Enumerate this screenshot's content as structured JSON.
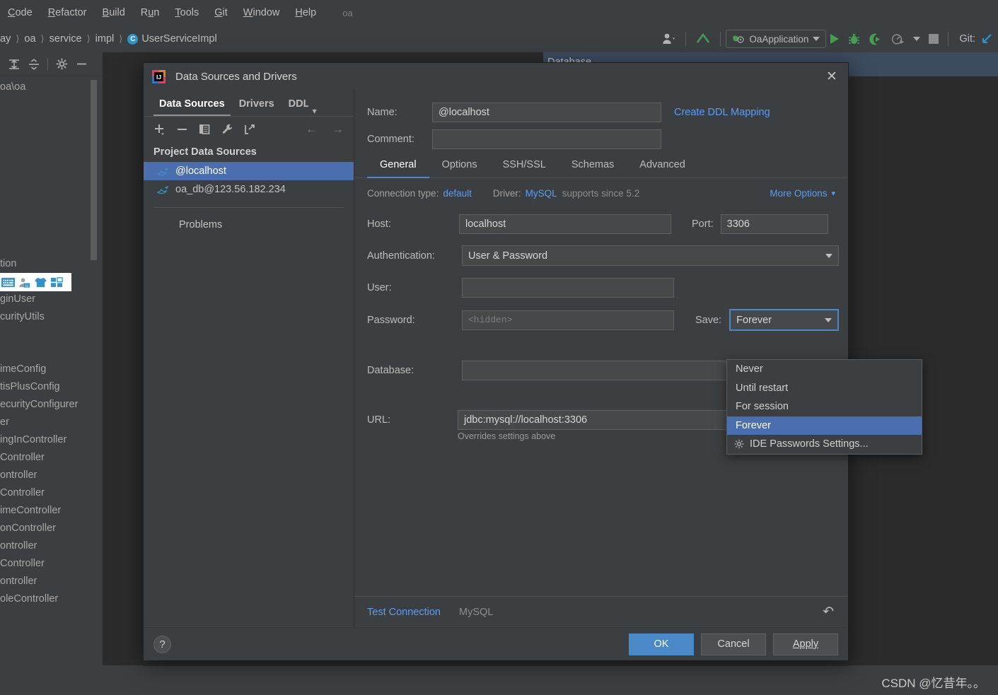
{
  "ide": {
    "menu": [
      "Code",
      "Refactor",
      "Build",
      "Run",
      "Tools",
      "Git",
      "Window",
      "Help"
    ],
    "project_hint": "oa",
    "breadcrumbs": [
      "ay",
      "oa",
      "service",
      "impl",
      "UserServiceImpl"
    ],
    "class_icon_letter": "C",
    "run_config": "OaApplication",
    "git_label": "Git:",
    "tool_window_title": "Database",
    "tree_items": [
      "oa\\oa",
      "",
      "",
      "",
      "",
      "",
      "",
      "",
      "",
      "",
      "tion",
      "",
      "ginUser",
      "curityUtils",
      "",
      "imeConfig",
      "tisPlusConfig",
      "ecurityConfigurer",
      "er",
      "ingInController",
      "Controller",
      "ontroller",
      "Controller",
      "imeController",
      "onController",
      "ontroller",
      "Controller",
      "ontroller",
      "oleController"
    ],
    "watermark": "CSDN @忆昔年。。"
  },
  "dialog": {
    "title": "Data Sources and Drivers",
    "logo_name": "intellij-idea-logo",
    "close_label": "✕",
    "left": {
      "tabs": [
        {
          "label": "Data Sources",
          "active": true
        },
        {
          "label": "Drivers",
          "active": false
        },
        {
          "label": "DDL",
          "active": false
        }
      ],
      "toolbar_icons": [
        "add-icon",
        "remove-icon",
        "copy-icon",
        "wrench-icon",
        "share-icon"
      ],
      "nav_back": "←",
      "nav_forward": "→",
      "group_title": "Project Data Sources",
      "items": [
        {
          "label": "@localhost",
          "selected": true,
          "icon": "mysql-dolphin-icon"
        },
        {
          "label": "oa_db@123.56.182.234",
          "selected": false,
          "icon": "mysql-dolphin-icon"
        }
      ],
      "problems_label": "Problems"
    },
    "form": {
      "name_label": "Name:",
      "name_value": "@localhost",
      "create_ddl_mapping": "Create DDL Mapping",
      "comment_label": "Comment:",
      "comment_value": "",
      "tabs": [
        {
          "label": "General",
          "active": true
        },
        {
          "label": "Options",
          "active": false
        },
        {
          "label": "SSH/SSL",
          "active": false
        },
        {
          "label": "Schemas",
          "active": false
        },
        {
          "label": "Advanced",
          "active": false
        }
      ],
      "connection_type_label": "Connection type:",
      "connection_type_value": "default",
      "driver_label": "Driver:",
      "driver_value": "MySQL",
      "driver_note": "supports since 5.2",
      "more_options": "More Options",
      "host_label": "Host:",
      "host_value": "localhost",
      "port_label": "Port:",
      "port_value": "3306",
      "auth_label": "Authentication:",
      "auth_value": "User & Password",
      "user_label": "User:",
      "user_value": "",
      "password_label": "Password:",
      "password_placeholder": "<hidden>",
      "save_label": "Save:",
      "save_value": "Forever",
      "database_label": "Database:",
      "database_value": "",
      "url_label": "URL:",
      "url_value": "jdbc:mysql://localhost:3306",
      "url_hint": "Overrides settings above"
    },
    "save_dropdown": {
      "options": [
        {
          "label": "Never",
          "selected": false,
          "icon": null
        },
        {
          "label": "Until restart",
          "selected": false,
          "icon": null
        },
        {
          "label": "For session",
          "selected": false,
          "icon": null
        },
        {
          "label": "Forever",
          "selected": true,
          "icon": null
        },
        {
          "label": "IDE Passwords Settings...",
          "selected": false,
          "icon": "gear-icon"
        }
      ]
    },
    "bottom": {
      "test_connection": "Test Connection",
      "dbms_label": "MySQL",
      "revert_icon": "revert-icon"
    },
    "footer": {
      "help": "?",
      "ok": "OK",
      "cancel": "Cancel",
      "apply": "Apply"
    }
  },
  "colors": {
    "accent_blue": "#4a88c7",
    "selection_blue": "#4b6eaf",
    "link_blue": "#589df6",
    "panel_bg": "#3c3f41",
    "editor_bg": "#2b2b2b",
    "green_run": "#499c54"
  }
}
